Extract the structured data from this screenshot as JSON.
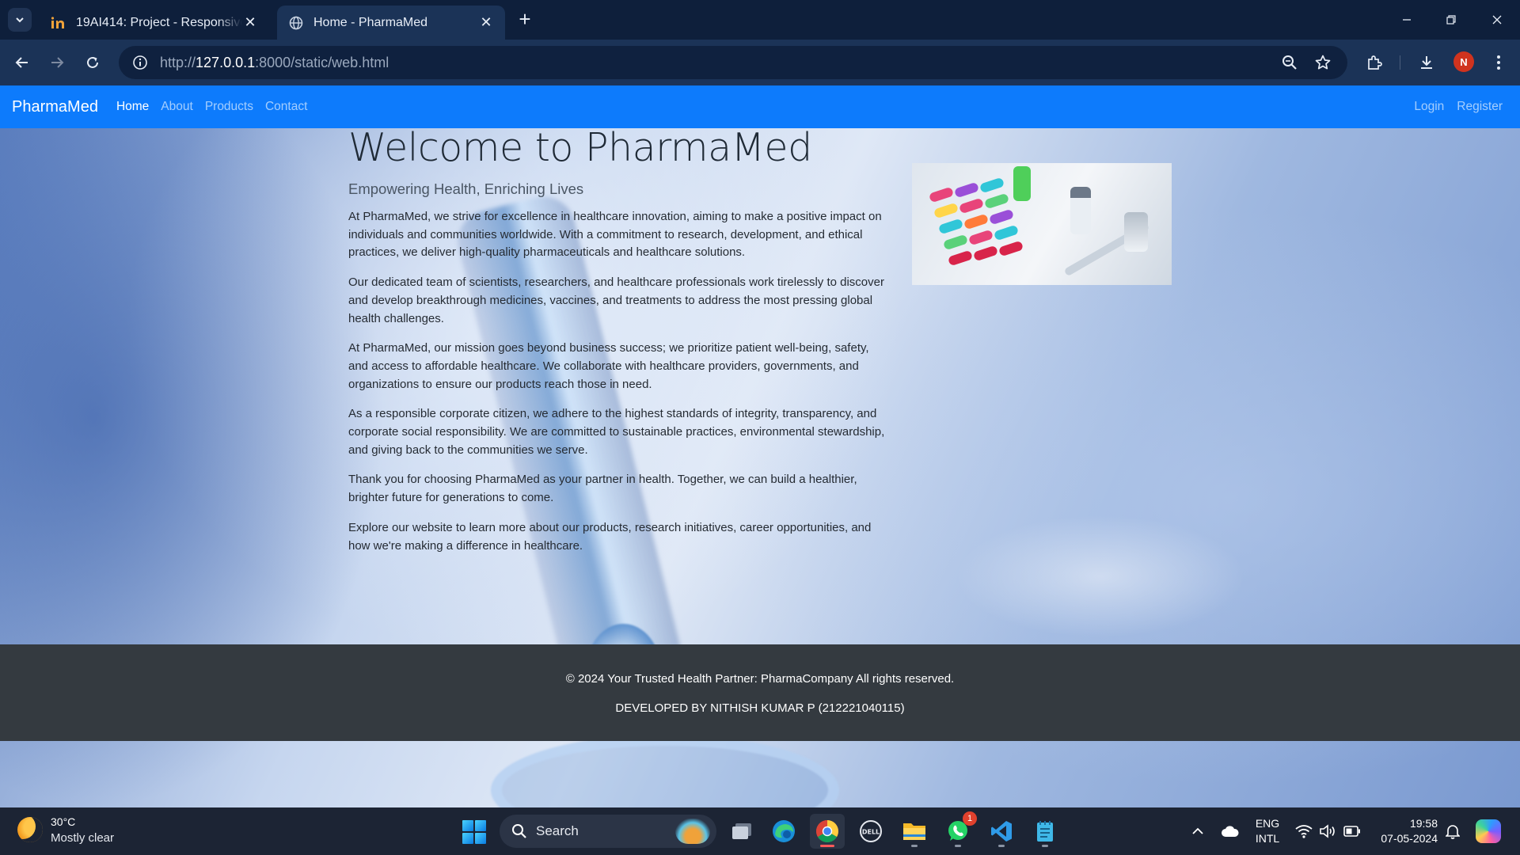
{
  "browser": {
    "tabs": [
      {
        "title": "19AI414: Project - Responsive W",
        "favicon": "in-logo-icon",
        "active": false
      },
      {
        "title": "Home - PharmaMed",
        "favicon": "globe-icon",
        "active": true
      }
    ],
    "url_prefix": "http://",
    "url_host": "127.0.0.1",
    "url_rest": ":8000/static/web.html",
    "profile_initial": "N"
  },
  "site": {
    "brand": "PharmaMed",
    "nav": [
      "Home",
      "About",
      "Products",
      "Contact"
    ],
    "nav_right": [
      "Login",
      "Register"
    ],
    "title": "Welcome to PharmaMed",
    "lead": "Empowering Health, Enriching Lives",
    "paragraphs": [
      "At PharmaMed, we strive for excellence in healthcare innovation, aiming to make a positive impact on individuals and communities worldwide. With a commitment to research, development, and ethical practices, we deliver high-quality pharmaceuticals and healthcare solutions.",
      "Our dedicated team of scientists, researchers, and healthcare professionals work tirelessly to discover and develop breakthrough medicines, vaccines, and treatments to address the most pressing global health challenges.",
      "At PharmaMed, our mission goes beyond business success; we prioritize patient well-being, safety, and access to affordable healthcare. We collaborate with healthcare providers, governments, and organizations to ensure our products reach those in need.",
      "As a responsible corporate citizen, we adhere to the highest standards of integrity, transparency, and corporate social responsibility. We are committed to sustainable practices, environmental stewardship, and giving back to the communities we serve.",
      "Thank you for choosing PharmaMed as your partner in health. Together, we can build a healthier, brighter future for generations to come.",
      "Explore our website to learn more about our products, research initiatives, career opportunities, and how we're making a difference in healthcare."
    ],
    "footer_copyright": "© 2024 Your Trusted Health Partner: PharmaCompany All rights reserved.",
    "footer_developer": "DEVELOPED BY NITHISH KUMAR P (212221040115)"
  },
  "taskbar": {
    "weather_temp": "30°C",
    "weather_desc": "Mostly clear",
    "search_label": "Search",
    "whatsapp_badge": "1",
    "lang_line1": "ENG",
    "lang_line2": "INTL",
    "time": "19:58",
    "date": "07-05-2024"
  },
  "colors": {
    "navbar": "#0d7bfc",
    "footer": "#343a40",
    "browser_frame": "#0e1f3b",
    "toolbar": "#1b3357"
  }
}
